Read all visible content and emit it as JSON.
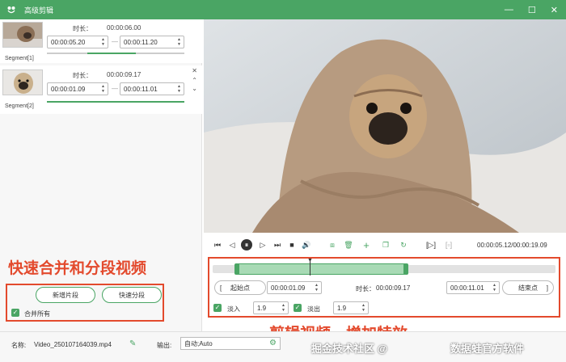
{
  "window": {
    "title": "高级剪辑",
    "minimize": "—",
    "maximize": "☐",
    "close": "✕"
  },
  "segments": [
    {
      "label": "Segment[1]",
      "duration_label": "时长：",
      "duration": "00:00:06.00",
      "start": "00:00:05.20",
      "end": "00:00:11.20"
    },
    {
      "label": "Segment[2]",
      "duration_label": "时长：",
      "duration": "00:00:09.17",
      "start": "00:00:01.09",
      "end": "00:00:11.01"
    }
  ],
  "left_actions": {
    "add_segment": "新增片段",
    "quick_split": "快速分段",
    "merge_all": "合并所有"
  },
  "annotations": {
    "left_caption": "快速合并和分段视频",
    "right_caption": "剪辑视频，增加特效"
  },
  "player": {
    "time_readout": "00:00:05.12/00:00:19.09"
  },
  "trim": {
    "start_label": "起始点",
    "start_value": "00:00:01.09",
    "duration_label": "时长：",
    "duration_value": "00:00:09.17",
    "end_value": "00:00:11.01",
    "end_label": "结束点",
    "fade_in_label": "淡入",
    "fade_in_value": "1.9",
    "fade_out_label": "淡出",
    "fade_out_value": "1.9"
  },
  "footer": {
    "name_label": "名称:",
    "file_name": "Video_250107164039.mp4",
    "output_label": "输出:",
    "output_value": "自动;Auto"
  },
  "watermark": {
    "left": "掘金技术社区 @",
    "right": "数据蛙官方软件"
  },
  "colors": {
    "accent": "#4aa564",
    "annotation": "#e34a2d"
  }
}
